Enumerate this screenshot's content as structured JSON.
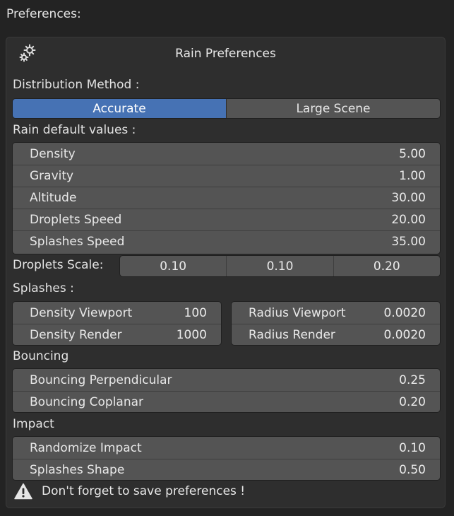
{
  "header": {
    "title": "Preferences:"
  },
  "panel": {
    "title": "Rain Preferences",
    "icon": "gears-icon"
  },
  "distribution": {
    "label": "Distribution Method :",
    "options": [
      "Accurate",
      "Large Scene"
    ],
    "selected": "Accurate",
    "accent": "#4672b4"
  },
  "rain_defaults": {
    "label": "Rain default values :",
    "fields": [
      {
        "label": "Density",
        "value": "5.00"
      },
      {
        "label": "Gravity",
        "value": "1.00"
      },
      {
        "label": "Altitude",
        "value": "30.00"
      },
      {
        "label": "Droplets Speed",
        "value": "20.00"
      },
      {
        "label": "Splashes Speed",
        "value": "35.00"
      }
    ]
  },
  "droplets_scale": {
    "label": "Droplets Scale:",
    "values": [
      "0.10",
      "0.10",
      "0.20"
    ]
  },
  "splashes": {
    "label": "Splashes :",
    "left": [
      {
        "label": "Density Viewport",
        "value": "100"
      },
      {
        "label": "Density Render",
        "value": "1000"
      }
    ],
    "right": [
      {
        "label": "Radius Viewport",
        "value": "0.0020"
      },
      {
        "label": "Radius Render",
        "value": "0.0020"
      }
    ]
  },
  "bouncing": {
    "label": "Bouncing",
    "fields": [
      {
        "label": "Bouncing Perpendicular",
        "value": "0.25"
      },
      {
        "label": "Bouncing Coplanar",
        "value": "0.20"
      }
    ]
  },
  "impact": {
    "label": "Impact",
    "fields": [
      {
        "label": "Randomize Impact",
        "value": "0.10"
      },
      {
        "label": "Splashes Shape",
        "value": "0.50"
      }
    ]
  },
  "warning": {
    "icon": "warning-icon",
    "text": "Don't forget to save preferences !"
  }
}
